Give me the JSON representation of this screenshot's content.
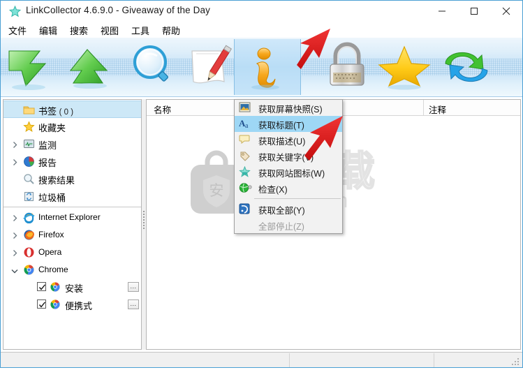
{
  "window": {
    "title": "LinkCollector 4.6.9.0 - Giveaway of the Day",
    "icon": "star-icon",
    "controls": {
      "minimize": "minimize-icon",
      "maximize": "maximize-icon",
      "close": "close-icon"
    }
  },
  "menubar": {
    "items": [
      {
        "label": "文件"
      },
      {
        "label": "编辑"
      },
      {
        "label": "搜索"
      },
      {
        "label": "视图"
      },
      {
        "label": "工具"
      },
      {
        "label": "帮助"
      }
    ]
  },
  "toolbar": {
    "buttons": [
      {
        "icon": "green-down-arrow-icon",
        "selected": false
      },
      {
        "icon": "green-up-arrow-icon",
        "selected": false
      },
      {
        "icon": "magnifier-icon",
        "selected": false
      },
      {
        "icon": "note-pencil-icon",
        "selected": false
      },
      {
        "icon": "info-icon",
        "selected": true
      },
      {
        "icon": "padlock-icon",
        "selected": false
      },
      {
        "icon": "star-icon",
        "selected": false
      },
      {
        "icon": "sync-arrows-icon",
        "selected": false
      }
    ],
    "overflow_icon": "chevron-down-icon"
  },
  "tree": {
    "items": [
      {
        "label": "书签",
        "count": "( 0 )",
        "icon": "folder-icon",
        "selected": true,
        "expander": "none",
        "indent": 0
      },
      {
        "label": "收藏夹",
        "count": "",
        "icon": "star-icon",
        "selected": false,
        "expander": "none",
        "indent": 0
      },
      {
        "label": "监测",
        "count": "",
        "icon": "monitor-icon",
        "selected": false,
        "expander": "collapsed",
        "indent": 0
      },
      {
        "label": "报告",
        "count": "",
        "icon": "piechart-icon",
        "selected": false,
        "expander": "collapsed",
        "indent": 0
      },
      {
        "label": "搜索结果",
        "count": "",
        "icon": "magnifier-icon",
        "selected": false,
        "expander": "none",
        "indent": 0
      },
      {
        "label": "垃圾桶",
        "count": "",
        "icon": "recycle-bin-icon",
        "selected": false,
        "expander": "none",
        "indent": 0
      },
      {
        "label": "Internet Explorer",
        "count": "",
        "icon": "ie-icon",
        "selected": false,
        "expander": "collapsed",
        "indent": 0
      },
      {
        "label": "Firefox",
        "count": "",
        "icon": "firefox-icon",
        "selected": false,
        "expander": "collapsed",
        "indent": 0
      },
      {
        "label": "Opera",
        "count": "",
        "icon": "opera-icon",
        "selected": false,
        "expander": "collapsed",
        "indent": 0
      },
      {
        "label": "Chrome",
        "count": "",
        "icon": "chrome-icon",
        "selected": false,
        "expander": "expanded",
        "indent": 0
      },
      {
        "label": "安装",
        "count": "",
        "icon": "chrome-icon",
        "selected": false,
        "expander": "none",
        "indent": 1,
        "checkbox": true,
        "checked": true,
        "more": "..."
      },
      {
        "label": "便携式",
        "count": "",
        "icon": "chrome-icon",
        "selected": false,
        "expander": "none",
        "indent": 1,
        "checkbox": true,
        "checked": true,
        "more": "..."
      }
    ]
  },
  "list": {
    "columns": [
      {
        "label": "名称"
      },
      {
        "label": "注释"
      }
    ],
    "rows": []
  },
  "context_menu": {
    "items": [
      {
        "label": "获取屏幕快照(S)",
        "icon": "screenshot-icon",
        "selected": false,
        "disabled": false,
        "separator_before": false
      },
      {
        "label": "获取标题(T)",
        "icon": "title-aa-icon",
        "selected": true,
        "disabled": false,
        "separator_before": false
      },
      {
        "label": "获取描述(U)",
        "icon": "speech-bubble-icon",
        "selected": false,
        "disabled": false,
        "separator_before": false
      },
      {
        "label": "获取关键字(V)",
        "icon": "tag-icon",
        "selected": false,
        "disabled": false,
        "separator_before": false
      },
      {
        "label": "获取网站图标(W)",
        "icon": "favicon-star-icon",
        "selected": false,
        "disabled": false,
        "separator_before": false
      },
      {
        "label": "检查(X)",
        "icon": "globe-check-icon",
        "selected": false,
        "disabled": false,
        "separator_before": false
      },
      {
        "label": "获取全部(Y)",
        "icon": "get-all-icon",
        "selected": false,
        "disabled": false,
        "separator_before": true
      },
      {
        "label": "全部停止(Z)",
        "icon": "none",
        "selected": false,
        "disabled": true,
        "separator_before": false
      }
    ]
  },
  "watermark": {
    "text": "安下载",
    "sub": "anxz.com",
    "badge_char": "安",
    "icon": "bag-shield-icon"
  },
  "annotations": [
    {
      "name": "arrow-to-info-toolbar-button",
      "icon": "red-arrow-icon"
    },
    {
      "name": "arrow-to-get-favicon-menu-item",
      "icon": "red-arrow-icon"
    }
  ],
  "statusbar": {
    "panels": [
      "",
      "",
      ""
    ],
    "grip": "resize-grip-icon"
  },
  "colors": {
    "accent": "#4a9fd4",
    "selection": "#cde8f7",
    "menu_highlight": "#9ed7f5",
    "toolbar_bg": "#cfe6f8",
    "annotation_red": "#e01b1b"
  }
}
